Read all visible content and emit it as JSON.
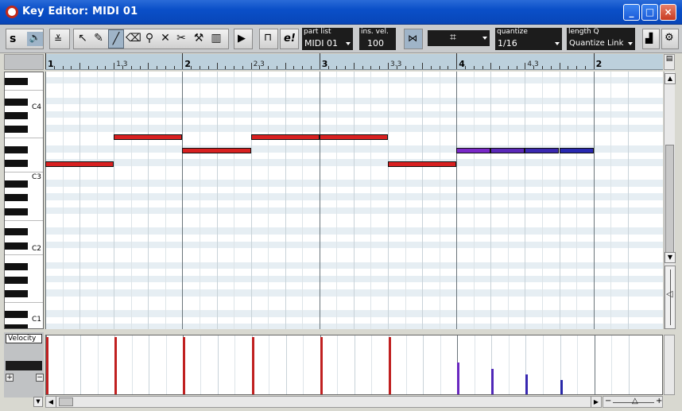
{
  "window": {
    "title": "Key Editor: MIDI 01",
    "min_label": "_",
    "max_label": "□",
    "close_label": "×"
  },
  "toolbar": {
    "solo_label": "s",
    "part_list_label": "part list",
    "part_list_value": "MIDI 01",
    "ins_vel_label": "ins. vel.",
    "ins_vel_value": "100",
    "grid_symbol": "⌗",
    "quantize_label": "quantize",
    "quantize_value": "1/16",
    "length_q_label": "length Q",
    "length_q_value": "Quantize Link",
    "e_button_label": "e!",
    "tools": [
      "arrow-icon",
      "pencil-icon",
      "line-icon",
      "eraser-icon",
      "zoom-icon",
      "mute-icon",
      "scissors-icon",
      "glue-icon",
      "draw-icon"
    ]
  },
  "ruler": {
    "labels": [
      {
        "text": "1",
        "beat": 0,
        "bar": true
      },
      {
        "text": "1.3",
        "beat": 2,
        "bar": false
      },
      {
        "text": "2",
        "beat": 4,
        "bar": true
      },
      {
        "text": "2.3",
        "beat": 6,
        "bar": false
      },
      {
        "text": "3",
        "beat": 8,
        "bar": true
      },
      {
        "text": "3.3",
        "beat": 10,
        "bar": false
      },
      {
        "text": "4",
        "beat": 12,
        "bar": true
      },
      {
        "text": "4.3",
        "beat": 14,
        "bar": false
      },
      {
        "text": "2",
        "beat": 16,
        "bar": true
      }
    ]
  },
  "keyboard": {
    "octave_labels": [
      "C4",
      "C3",
      "C2",
      "C1"
    ]
  },
  "notes": [
    {
      "start": 0,
      "length": 2,
      "pitch": "C3",
      "color": "#d82020"
    },
    {
      "start": 2,
      "length": 2,
      "pitch": "E3",
      "color": "#d82020"
    },
    {
      "start": 4,
      "length": 2,
      "pitch": "D3",
      "color": "#d82020"
    },
    {
      "start": 6,
      "length": 2,
      "pitch": "E3",
      "color": "#d82020"
    },
    {
      "start": 8,
      "length": 2,
      "pitch": "E3",
      "color": "#d82020"
    },
    {
      "start": 10,
      "length": 2,
      "pitch": "C3",
      "color": "#d82020"
    },
    {
      "start": 12,
      "length": 1,
      "pitch": "D3",
      "color": "#7a28c8"
    },
    {
      "start": 13,
      "length": 1,
      "pitch": "D3",
      "color": "#5a28b8"
    },
    {
      "start": 14,
      "length": 1,
      "pitch": "D3",
      "color": "#3a28b0"
    },
    {
      "start": 15,
      "length": 1,
      "pitch": "D3",
      "color": "#2828b0"
    }
  ],
  "velocity": [
    {
      "beat": 0,
      "value": 100,
      "color": "#c02020"
    },
    {
      "beat": 2,
      "value": 100,
      "color": "#c02020"
    },
    {
      "beat": 4,
      "value": 100,
      "color": "#c02020"
    },
    {
      "beat": 6,
      "value": 100,
      "color": "#c02020"
    },
    {
      "beat": 8,
      "value": 100,
      "color": "#c02020"
    },
    {
      "beat": 10,
      "value": 100,
      "color": "#c02020"
    },
    {
      "beat": 12,
      "value": 55,
      "color": "#6a28c0"
    },
    {
      "beat": 13,
      "value": 45,
      "color": "#5028b8"
    },
    {
      "beat": 14,
      "value": 35,
      "color": "#3828b0"
    },
    {
      "beat": 15,
      "value": 25,
      "color": "#2828a8"
    }
  ],
  "controller": {
    "lane_label": "Velocity"
  }
}
